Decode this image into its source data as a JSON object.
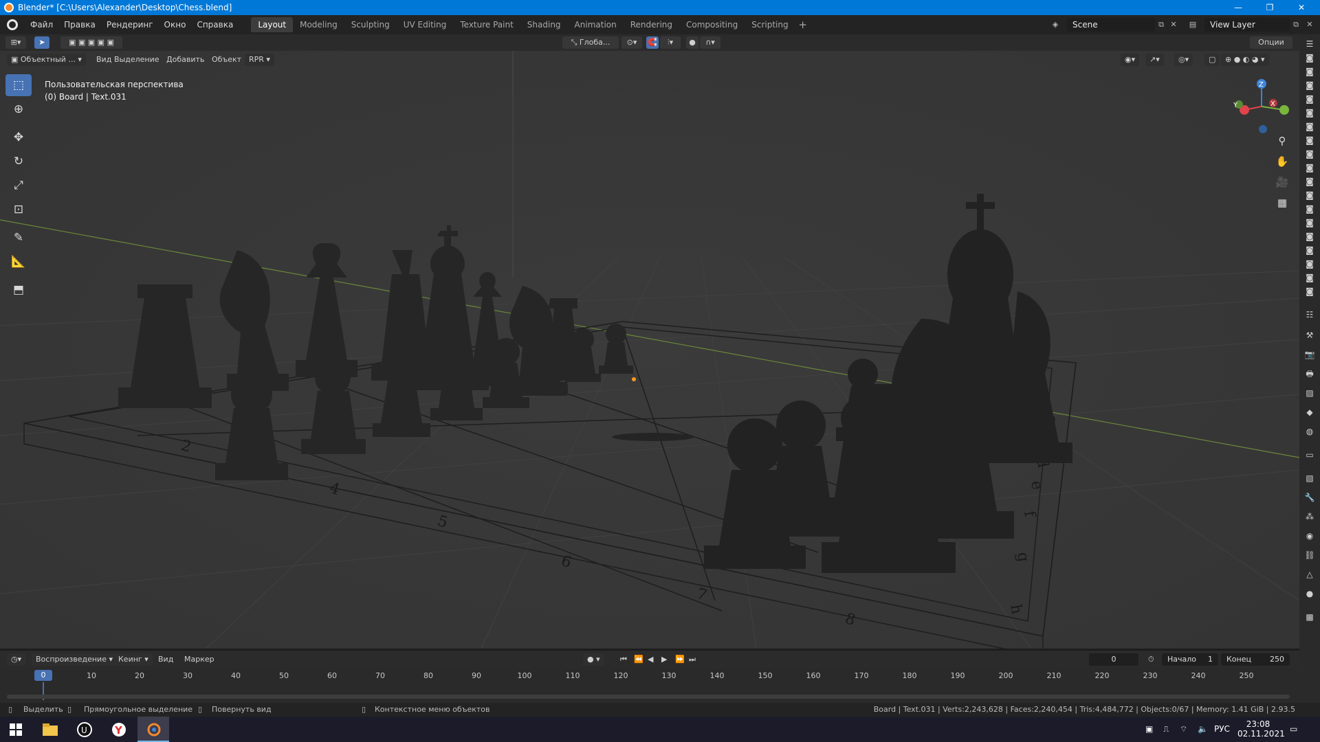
{
  "window": {
    "title": "Blender* [C:\\Users\\Alexander\\Desktop\\Chess.blend]",
    "controls": [
      "—",
      "❐",
      "✕"
    ]
  },
  "menu": {
    "items": [
      "Файл",
      "Правка",
      "Рендеринг",
      "Окно",
      "Справка"
    ]
  },
  "workspaces": {
    "tabs": [
      "Layout",
      "Modeling",
      "Sculpting",
      "UV Editing",
      "Texture Paint",
      "Shading",
      "Animation",
      "Rendering",
      "Compositing",
      "Scripting"
    ],
    "active": "Layout",
    "add": "+"
  },
  "scene": {
    "scene_name": "Scene",
    "view_layer": "View Layer"
  },
  "tool_header": {
    "transform_orientation": "Глоба...",
    "options": "Опции"
  },
  "viewport_header": {
    "mode": "Объектный ...",
    "menus": [
      "Вид",
      "Выделение",
      "Добавить",
      "Объект",
      "RPR"
    ]
  },
  "viewport": {
    "perspective_label": "Пользовательская перспектива",
    "object_label": "(0) Board | Text.031",
    "board_ranks": [
      "2",
      "3",
      "4",
      "5",
      "6",
      "7",
      "8"
    ],
    "board_files": [
      "h",
      "g",
      "f",
      "e",
      "d",
      "c",
      "b",
      "a"
    ],
    "gizmo_axes": [
      "Z",
      "Y",
      "X"
    ]
  },
  "timeline": {
    "menus": [
      "Воспроизведение",
      "Кеинг",
      "Вид",
      "Маркер"
    ],
    "current_frame": "0",
    "start_label": "Начало",
    "start_value": "1",
    "end_label": "Конец",
    "end_value": "250",
    "ticks": [
      "0",
      "10",
      "20",
      "30",
      "40",
      "50",
      "60",
      "70",
      "80",
      "90",
      "100",
      "110",
      "120",
      "130",
      "140",
      "150",
      "160",
      "170",
      "180",
      "190",
      "200",
      "210",
      "220",
      "230",
      "240",
      "250"
    ]
  },
  "statusbar": {
    "select": "Выделить",
    "box_select": "Прямоугольное выделение",
    "rotate_view": "Повернуть вид",
    "context_menu": "Контекстное меню объектов",
    "stats": "Board | Text.031 | Verts:2,243,628 | Faces:2,240,454 | Tris:4,484,772 | Objects:0/67 | Memory: 1.41 GiB | 2.93.5"
  },
  "taskbar": {
    "lang": "РУС",
    "time": "23:08",
    "date": "02.11.2021"
  },
  "colors": {
    "accent": "#4772b3",
    "titlebar": "#0078d7",
    "viewport_bg": "#393939",
    "axis_x": "#e0434a",
    "axis_y": "#7ab53c",
    "axis_z": "#3e84d8"
  }
}
